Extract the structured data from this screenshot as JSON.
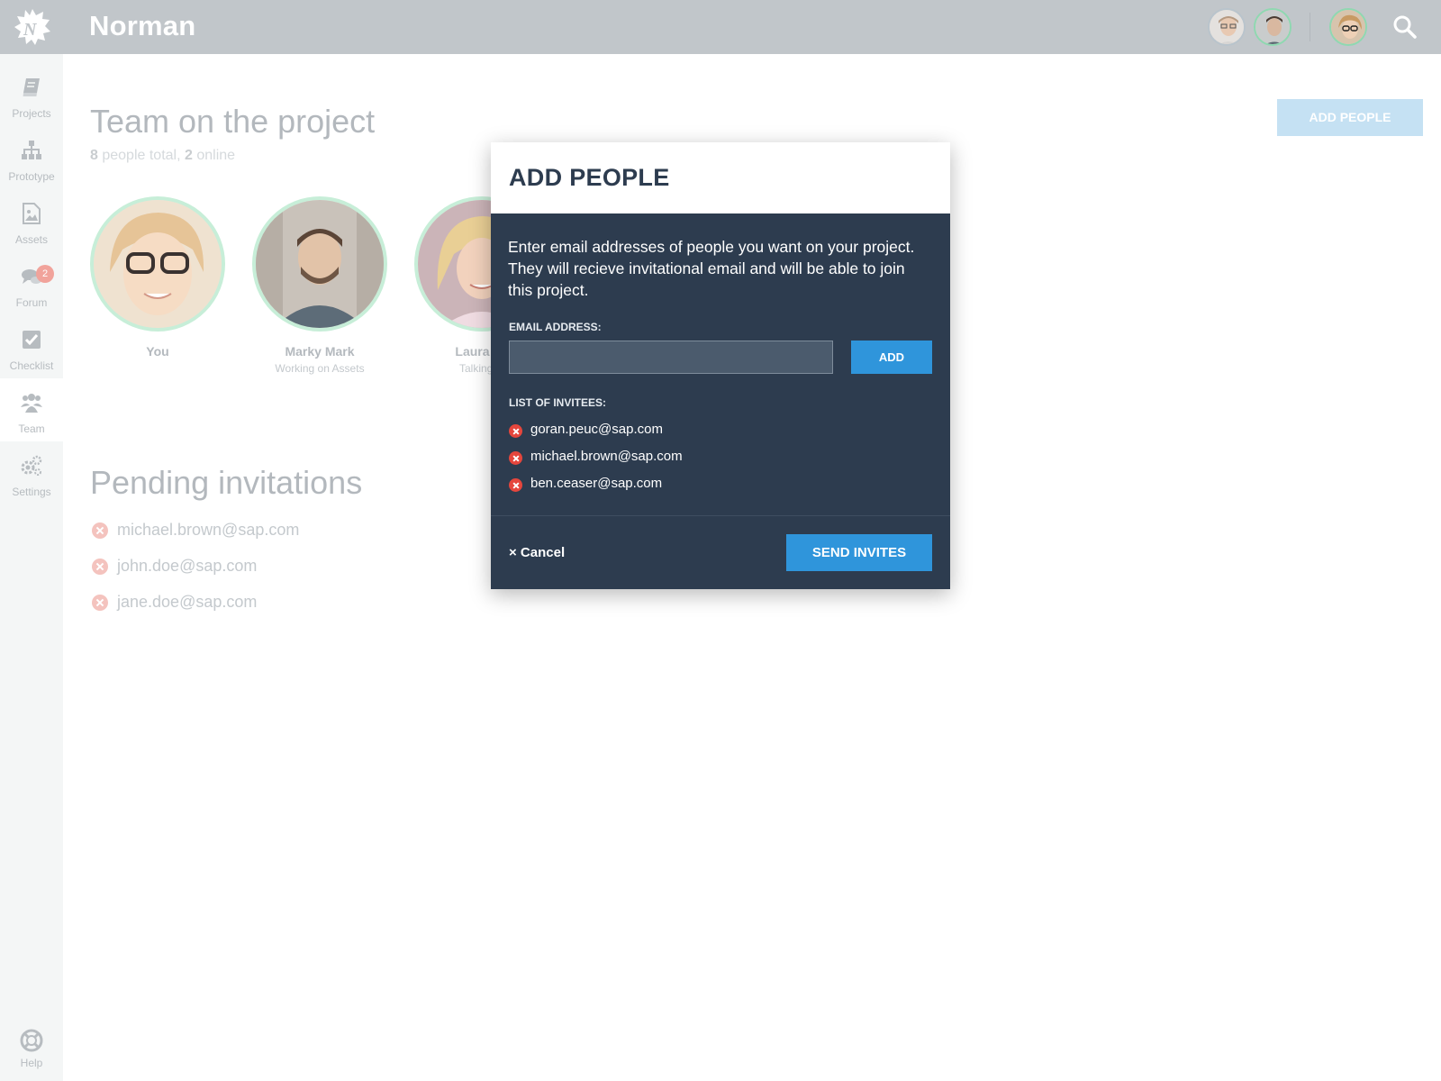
{
  "app": {
    "name": "Norman",
    "logo_icon": "norman-burst-logo-icon"
  },
  "topbar": {
    "avatars": [
      "collaborator-avatar-1",
      "collaborator-avatar-2",
      "current-user-avatar"
    ],
    "search_icon": "search-icon"
  },
  "sidebar": {
    "items": [
      {
        "label": "Projects",
        "icon": "book-icon"
      },
      {
        "label": "Prototype",
        "icon": "sitemap-icon"
      },
      {
        "label": "Assets",
        "icon": "image-file-icon"
      },
      {
        "label": "Forum",
        "icon": "chat-bubbles-icon",
        "badge": "2"
      },
      {
        "label": "Checklist",
        "icon": "checkbox-icon"
      },
      {
        "label": "Team",
        "icon": "people-icon",
        "active": true
      },
      {
        "label": "Settings",
        "icon": "gears-icon"
      }
    ],
    "help": {
      "label": "Help",
      "icon": "lifebuoy-icon"
    }
  },
  "page": {
    "title": "Team on the project",
    "total_count": "8",
    "total_label": "people total,",
    "online_count": "2",
    "online_label": "online",
    "add_people_button": "ADD PEOPLE",
    "members": [
      {
        "name": "You",
        "status": ""
      },
      {
        "name": "Marky Mark",
        "status": "Working on Assets"
      },
      {
        "name": "Laura Pa",
        "status": "Talking in"
      }
    ],
    "pending_title": "Pending invitations",
    "pending": [
      "michael.brown@sap.com",
      "john.doe@sap.com",
      "jane.doe@sap.com"
    ]
  },
  "modal": {
    "title": "ADD PEOPLE",
    "description": "Enter email addresses of people you want on your project. They will recieve invitational email and will be able to join this project.",
    "email_label": "EMAIL ADDRESS:",
    "email_value": "",
    "email_placeholder": "",
    "add_button": "ADD",
    "list_label": "LIST OF INVITEES:",
    "invitees": [
      "goran.peuc@sap.com",
      "michael.brown@sap.com",
      "ben.ceaser@sap.com"
    ],
    "cancel_button": "× Cancel",
    "send_button": "SEND INVITES"
  },
  "colors": {
    "topbar": "#c1c6ca",
    "modal_bg": "#2d3c4f",
    "primary": "#2f95db",
    "remove_red": "#e5463d",
    "online_ring": "#8fd8b1"
  }
}
